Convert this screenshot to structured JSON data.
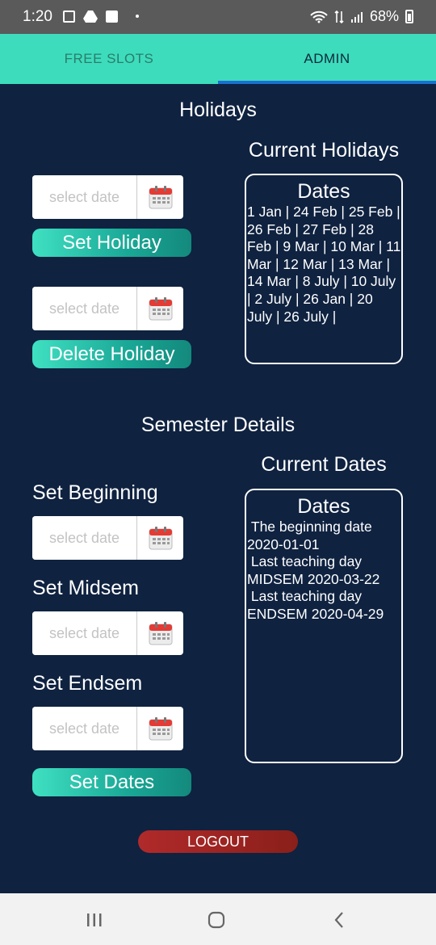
{
  "status_bar": {
    "time": "1:20",
    "battery": "68%"
  },
  "tabs": [
    {
      "label": "FREE SLOTS",
      "active": false
    },
    {
      "label": "ADMIN",
      "active": true
    }
  ],
  "holidays": {
    "heading": "Holidays",
    "set_date_placeholder": "select date",
    "set_button": "Set Holiday",
    "delete_date_placeholder": "select date",
    "delete_button": "Delete Holiday",
    "current_heading": "Current Holidays",
    "panel_title": "Dates",
    "dates_text": "1 Jan |  24 Feb |  25 Feb |  26 Feb |  27 Feb |  28 Feb |  9 Mar |  10 Mar |  11 Mar |  12 Mar |  13 Mar |  14 Mar |  8 July |  10 July |  2 July |  26 Jan |  20 July |  26 July |"
  },
  "semester": {
    "heading": "Semester Details",
    "current_heading": "Current Dates",
    "beginning_label": "Set Beginning",
    "beginning_placeholder": "select date",
    "midsem_label": "Set Midsem",
    "midsem_placeholder": "select date",
    "endsem_label": "Set Endsem",
    "endsem_placeholder": "select date",
    "set_button": "Set Dates",
    "panel_title": "Dates",
    "dates_text": " The beginning date\n2020-01-01\n Last teaching day\nMIDSEM 2020-03-22\n Last teaching day\nENDSEM 2020-04-29"
  },
  "logout_label": "LOGOUT",
  "colors": {
    "background": "#0f2240",
    "accent": "#3ddcbc",
    "tab_indicator": "#1a6fd1",
    "logout": "#a02525"
  }
}
